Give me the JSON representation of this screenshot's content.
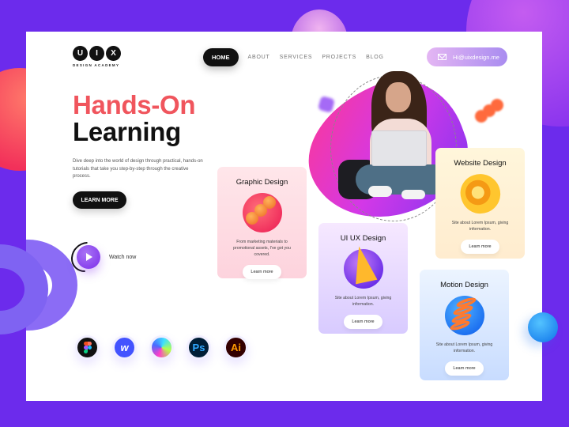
{
  "logo": {
    "letters": [
      "U",
      "I",
      "X"
    ],
    "subtitle": "DESIGN ACADEMY"
  },
  "nav": {
    "items": [
      {
        "label": "HOME",
        "active": true
      },
      {
        "label": "ABOUT",
        "active": false
      },
      {
        "label": "SERVICES",
        "active": false
      },
      {
        "label": "PROJECTS",
        "active": false
      },
      {
        "label": "BLOG",
        "active": false
      }
    ]
  },
  "contact": {
    "email": "Hi@uixdesign.me",
    "icon": "mail-icon"
  },
  "hero": {
    "title_line1": "Hands-On",
    "title_line2": "Learning",
    "description": "Dive deep into the world of design through practical, hands-on tutorials that take you step-by-step through the creative process.",
    "cta_label": "LEARN MORE",
    "watch_label": "Watch now"
  },
  "tools": [
    {
      "name": "figma",
      "label": ""
    },
    {
      "name": "webflow",
      "label": "w"
    },
    {
      "name": "gradient-app",
      "label": ""
    },
    {
      "name": "photoshop",
      "label": "Ps"
    },
    {
      "name": "illustrator",
      "label": "Ai"
    }
  ],
  "services": [
    {
      "title": "Graphic Design",
      "description": "From marketing materials to promotional assets, I've got you covered.",
      "button": "Learn more"
    },
    {
      "title": "UI UX Design",
      "description": "Site about Lorem Ipsum, giving information.",
      "button": "Learn more"
    },
    {
      "title": "Website Design",
      "description": "Site about Lorem Ipsum, giving information.",
      "button": "Learn more"
    },
    {
      "title": "Motion Design",
      "description": "Site about Lorem Ipsum, giving information.",
      "button": "Learn more"
    }
  ],
  "colors": {
    "background": "#6c2bec",
    "accent_red": "#f0555d",
    "dark": "#111111"
  }
}
